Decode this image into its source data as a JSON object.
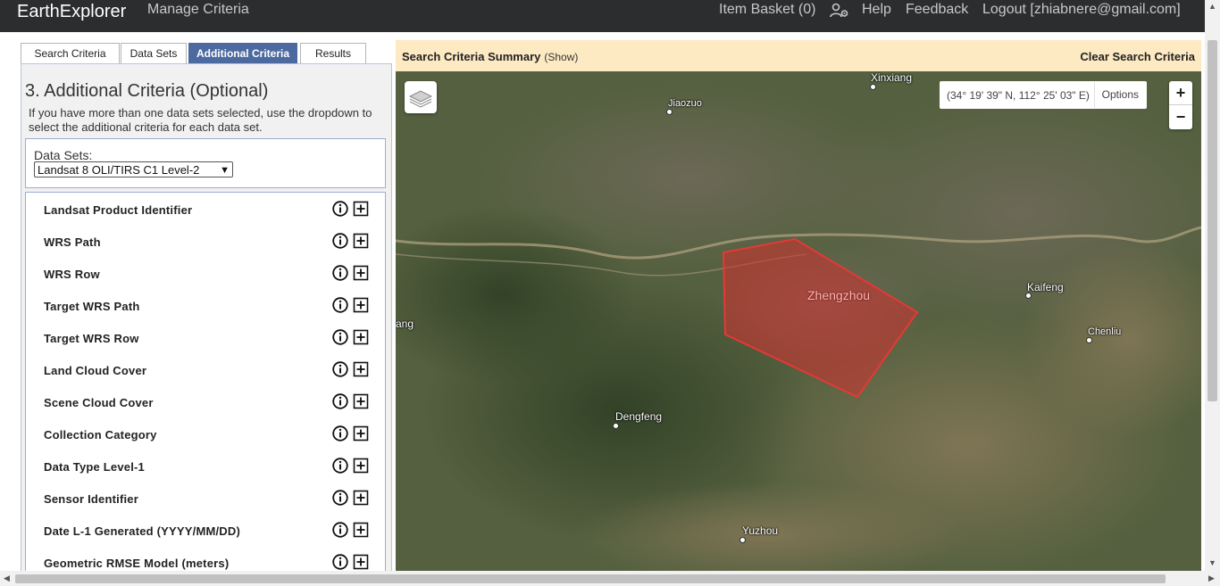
{
  "navbar": {
    "brand": "EarthExplorer",
    "manage_criteria": "Manage Criteria",
    "item_basket": "Item Basket (0)",
    "settings_icon": "user-settings-icon",
    "help": "Help",
    "feedback": "Feedback",
    "logout": "Logout [zhiabnere@gmail.com]"
  },
  "tabs": [
    {
      "label": "Search Criteria",
      "active": false
    },
    {
      "label": "Data Sets",
      "active": false
    },
    {
      "label": "Additional Criteria",
      "active": true
    },
    {
      "label": "Results",
      "active": false
    }
  ],
  "panel": {
    "title": "3. Additional Criteria (Optional)",
    "description": "If you have more than one data sets selected, use the dropdown to select the additional criteria for each data set.",
    "datasets_label": "Data Sets:",
    "datasets_selected": "Landsat 8 OLI/TIRS C1 Level-2"
  },
  "criteria": [
    "Landsat Product Identifier",
    "WRS Path",
    "WRS Row",
    "Target WRS Path",
    "Target WRS Row",
    "Land Cloud Cover",
    "Scene Cloud Cover",
    "Collection Category",
    "Data Type Level-1",
    "Sensor Identifier",
    "Date L-1 Generated (YYYY/MM/DD)",
    "Geometric RMSE Model (meters)"
  ],
  "map_header": {
    "title": "Search Criteria Summary",
    "show": "(Show)",
    "clear": "Clear Search Criteria"
  },
  "map": {
    "coordinates": "(34° 19' 39\" N, 112° 25' 03\" E)",
    "options": "Options",
    "zoom_in": "+",
    "zoom_out": "−",
    "aoi_label": "Zhengzhou",
    "aoi_color": "#d32f2f",
    "cities": {
      "xinxiang": "Xinxiang",
      "jiaozuo": "Jiaozuo",
      "kaifeng": "Kaifeng",
      "chenliu": "Chenliu",
      "dengfeng": "Dengfeng",
      "yuzhou": "Yuzhou",
      "luoyang_partial": "ang"
    }
  },
  "colors": {
    "navbar": "#2b2d2f",
    "tab_active": "#4c6aa0",
    "map_header": "#fde9c2"
  }
}
